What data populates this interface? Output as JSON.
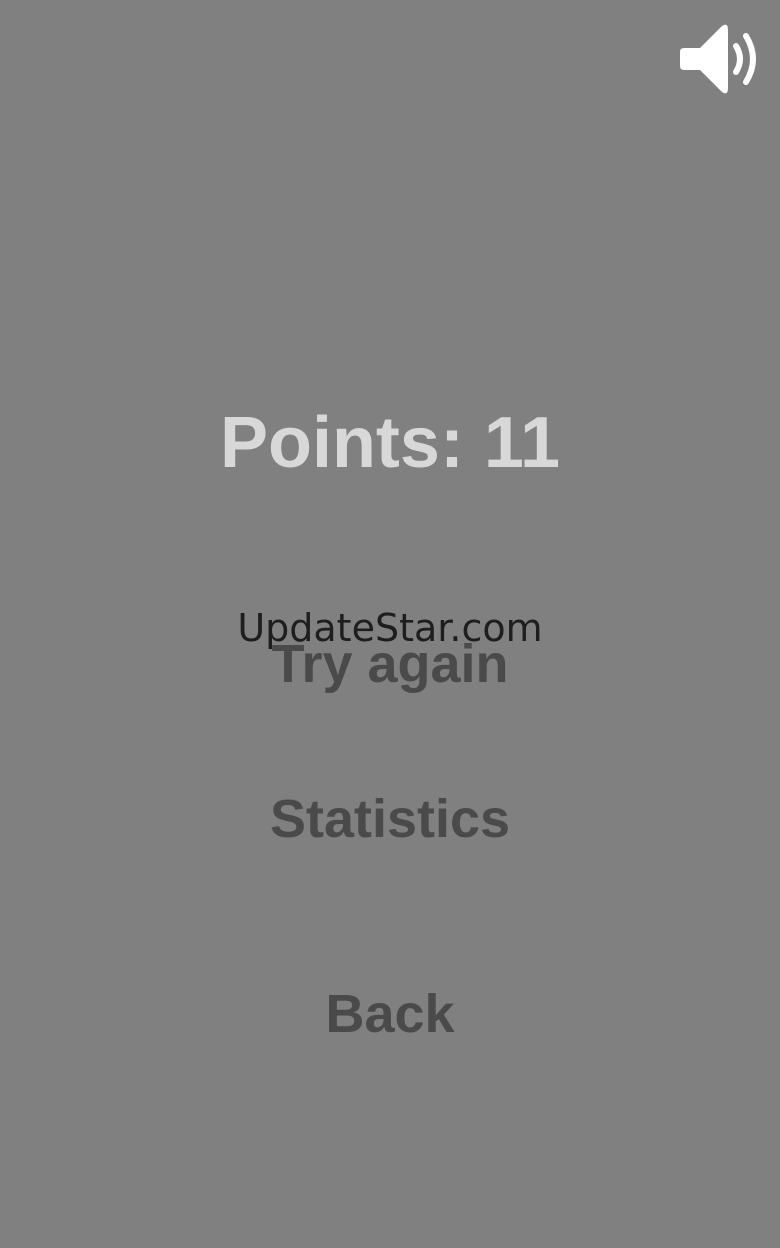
{
  "header": {
    "sound_icon": "speaker-volume-icon"
  },
  "score": {
    "points_text": "Points: 11"
  },
  "menu": {
    "try_again_label": "Try again",
    "statistics_label": "Statistics",
    "back_label": "Back"
  },
  "watermark": {
    "text": "UpdateStar.com"
  },
  "colors": {
    "background": "#808080",
    "points_text": "#d8d8d8",
    "menu_text": "#4a4a4a",
    "icon": "#ffffff"
  }
}
